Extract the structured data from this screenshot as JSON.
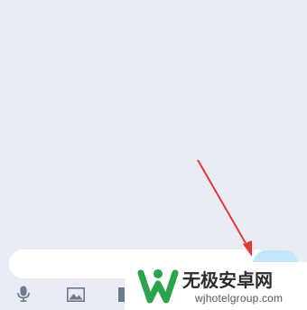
{
  "chat": {
    "background_color": "#e9ecf4"
  },
  "composer": {
    "input_value": "",
    "send_button_color": "#c3e7f6"
  },
  "toolbar": {
    "icons": [
      "microphone-icon",
      "image-icon",
      "file-icon"
    ]
  },
  "annotation": {
    "arrow_color": "#e53935",
    "points_to": "send-button"
  },
  "watermark": {
    "title": "无极安卓网",
    "url": "wjhotelgroup.com",
    "brand_color": "#2aa44a"
  }
}
